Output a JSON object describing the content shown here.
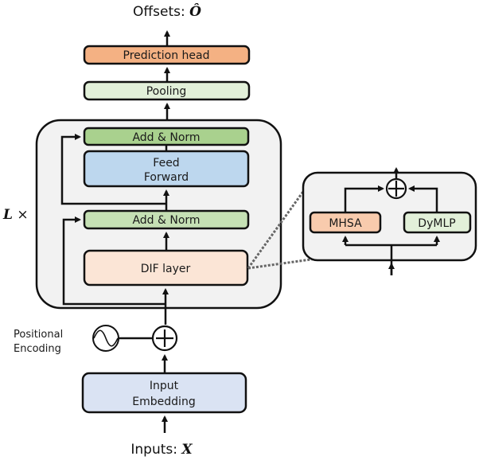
{
  "output_label": {
    "prefix": "Offsets:",
    "symbol": "Ô"
  },
  "input_label": {
    "prefix": "Inputs:",
    "symbol": "X"
  },
  "repeat_label": {
    "symbol": "L",
    "times": "×"
  },
  "blocks": {
    "prediction_head": "Prediction head",
    "pooling": "Pooling",
    "add_norm_top": "Add & Norm",
    "feed_forward_line1": "Feed",
    "feed_forward_line2": "Forward",
    "add_norm_bottom": "Add & Norm",
    "dif_layer": "DIF layer",
    "input_embedding_line1": "Input",
    "input_embedding_line2": "Embedding"
  },
  "positional_encoding": {
    "line1": "Positional",
    "line2": "Encoding"
  },
  "dif_detail": {
    "left_block": "MHSA",
    "right_block": "DyMLP"
  },
  "colors": {
    "prediction_head": "#F4B183",
    "pooling": "#E2F0D9",
    "add_norm_top": "#A9D18E",
    "feed_forward": "#BDD7EE",
    "add_norm_bottom": "#C5E0B4",
    "dif_layer": "#FBE5D6",
    "input_embedding": "#DAE3F3",
    "container": "#F2F2F2",
    "mhsa": "#F8CBAD",
    "dymlp": "#E2F0D9"
  }
}
